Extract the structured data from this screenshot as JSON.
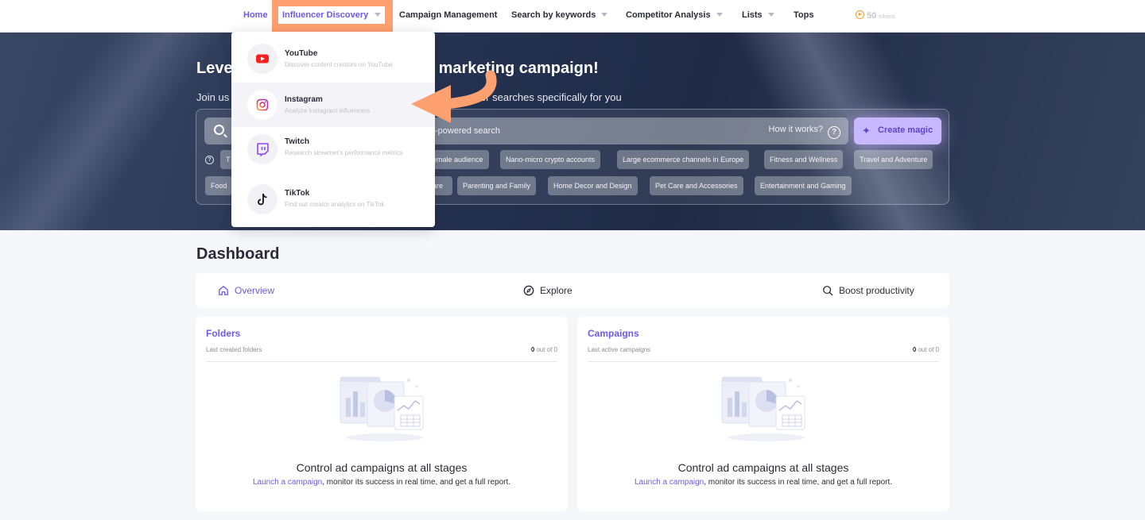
{
  "nav": {
    "home": "Home",
    "influencer_discovery": "Influencer Discovery",
    "campaign_management": "Campaign Management",
    "search_by_keywords": "Search by keywords",
    "competitor_analysis": "Competitor Analysis",
    "lists": "Lists",
    "tops": "Tops",
    "tokens_count": "50",
    "tokens_label": "tokens"
  },
  "hero": {
    "title_left": "Leve",
    "title_right": "marketing campaign!",
    "subtitle_left": "Join us",
    "subtitle_right": "ncer searches specifically for you",
    "search_placeholder": "-powered search",
    "how_it_works": "How it works?",
    "create_magic": "Create magic",
    "chips_row1": [
      "T",
      "emale audience",
      "Nano-micro crypto accounts",
      "Large ecommerce channels in Europe",
      "Fitness and Wellness",
      "Travel and Adventure"
    ],
    "chips_row2": [
      "Food",
      "are",
      "Parenting and Family",
      "Home Decor and Design",
      "Pet Care and Accessories",
      "Entertainment and Gaming"
    ]
  },
  "dropdown": {
    "items": [
      {
        "label": "YouTube",
        "desc": "Discover content creators on YouTube"
      },
      {
        "label": "Instagram",
        "desc": "Analyze Instagram influencers"
      },
      {
        "label": "Twitch",
        "desc": "Research streamer's performance metrics"
      },
      {
        "label": "TikTok",
        "desc": "Find out creator analytics on TikTok"
      }
    ]
  },
  "dashboard": {
    "title": "Dashboard",
    "tabs": {
      "overview": "Overview",
      "explore": "Explore",
      "boost": "Boost productivity"
    },
    "folders": {
      "title": "Folders",
      "subtitle": "Last created folders",
      "count": "0",
      "count_suffix": "out of 0",
      "heading": "Control ad campaigns at all stages",
      "link": "Launch a campaign",
      "text": ", monitor its success in real time, and get a full report."
    },
    "campaigns": {
      "title": "Campaigns",
      "subtitle": "Last active campaigns",
      "count": "0",
      "count_suffix": "out of 0",
      "heading": "Control ad campaigns at all stages",
      "link": "Launch a campaign",
      "text": ", monitor its success in real time, and get a full report."
    }
  },
  "colors": {
    "accent": "#6e5ae6",
    "highlight": "#ffa070",
    "hero_bg": "#243150"
  }
}
